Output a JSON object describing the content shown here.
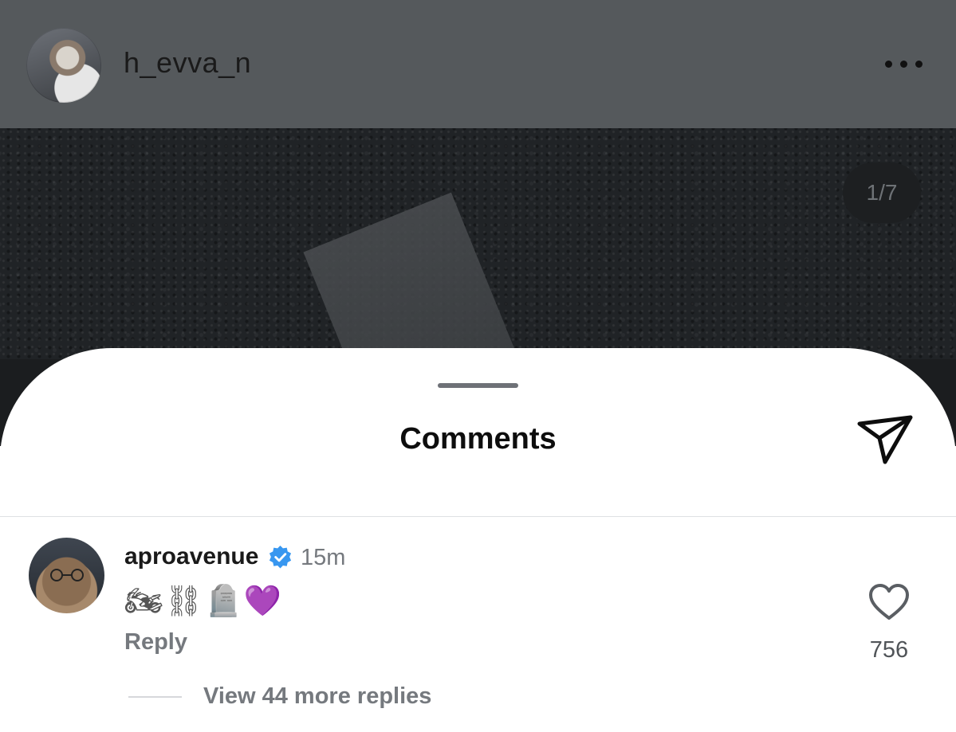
{
  "post": {
    "username": "h_evva_n",
    "page_indicator": "1/7"
  },
  "comments_sheet": {
    "title": "Comments"
  },
  "comment": {
    "username": "aproavenue",
    "time": "15m",
    "text": "🏍⛓🪦💜",
    "reply_label": "Reply",
    "like_count": "756",
    "view_replies_label": "View 44 more replies"
  },
  "icons": {
    "more": "more-horizontal-icon",
    "share": "send-icon",
    "verified": "verified-badge-icon",
    "like": "heart-icon"
  },
  "colors": {
    "verified": "#3897f0",
    "header_bg": "#55595c"
  }
}
